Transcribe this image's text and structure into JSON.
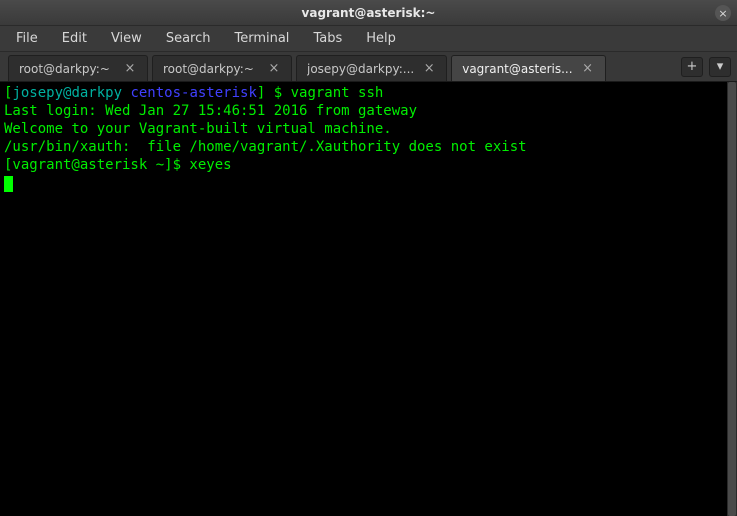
{
  "window": {
    "title": "vagrant@asterisk:~",
    "close_symbol": "×"
  },
  "menu": {
    "file": "File",
    "edit": "Edit",
    "view": "View",
    "search": "Search",
    "terminal": "Terminal",
    "tabs": "Tabs",
    "help": "Help"
  },
  "tabs": [
    {
      "label": "root@darkpy:~",
      "active": false
    },
    {
      "label": "root@darkpy:~",
      "active": false
    },
    {
      "label": "josepy@darkpy:...",
      "active": false
    },
    {
      "label": "vagrant@asteris...",
      "active": true
    }
  ],
  "tab_close_symbol": "×",
  "newtab_symbol": "+",
  "dropdown_symbol": "▾",
  "terminal_lines": {
    "l0_user": "josepy@darkpy",
    "l0_host": " centos-asterisk",
    "l0_rest": "] $ vagrant ssh",
    "l1": "Last login: Wed Jan 27 15:46:51 2016 from gateway",
    "l2": "Welcome to your Vagrant-built virtual machine.",
    "l3": "/usr/bin/xauth:  file /home/vagrant/.Xauthority does not exist",
    "l4": "[vagrant@asterisk ~]$ xeyes"
  }
}
